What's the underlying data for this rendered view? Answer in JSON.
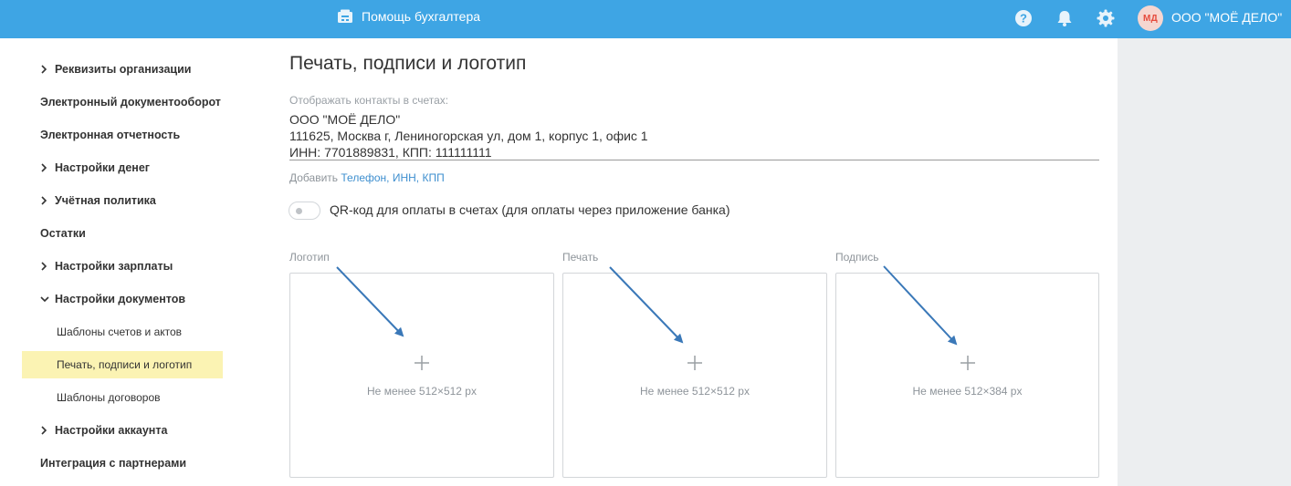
{
  "header": {
    "helper_label": "Помощь бухгалтера",
    "avatar_initials": "МД",
    "org_name": "ООО \"МОЁ ДЕЛО\"",
    "icons": [
      "help-icon",
      "bell-icon",
      "gear-icon"
    ]
  },
  "sidebar": {
    "items": [
      {
        "label": "Реквизиты организации",
        "expandable": true
      },
      {
        "label": "Электронный документооборот",
        "expandable": false
      },
      {
        "label": "Электронная отчетность",
        "expandable": false
      },
      {
        "label": "Настройки денег",
        "expandable": true
      },
      {
        "label": "Учётная политика",
        "expandable": true
      },
      {
        "label": "Остатки",
        "expandable": false
      },
      {
        "label": "Настройки зарплаты",
        "expandable": true
      },
      {
        "label": "Настройки документов",
        "expandable": true,
        "expanded": true
      },
      {
        "label": "Шаблоны счетов и актов",
        "sub": true
      },
      {
        "label": "Печать, подписи и логотип",
        "sub": true,
        "active": true
      },
      {
        "label": "Шаблоны договоров",
        "sub": true
      },
      {
        "label": "Настройки аккаунта",
        "expandable": true
      },
      {
        "label": "Интеграция с партнерами",
        "expandable": false
      }
    ]
  },
  "main": {
    "title": "Печать, подписи и логотип",
    "contacts_label": "Отображать контакты в счетах:",
    "contacts_lines": [
      "ООО \"МОЁ ДЕЛО\"",
      "111625, Москва г, Лениногорская ул, дом 1, корпус 1, офис 1",
      "ИНН: 7701889831, КПП: 111111111"
    ],
    "add_prefix": "Добавить",
    "add_links": "Телефон, ИНН, КПП",
    "qr_toggle_label": "QR-код для оплаты в счетах (для оплаты через приложение банка)",
    "qr_toggle_on": false,
    "uploads": [
      {
        "label": "Логотип",
        "hint": "Не менее 512×512 px"
      },
      {
        "label": "Печать",
        "hint": "Не менее 512×512 px"
      },
      {
        "label": "Подпись",
        "hint": "Не менее 512×384 px"
      }
    ]
  },
  "colors": {
    "topbar": "#3ea5e4",
    "active_item": "#fbf3b3",
    "link": "#3e8fcf",
    "arrow": "#3a78b8",
    "right_panel": "#eceef0"
  }
}
